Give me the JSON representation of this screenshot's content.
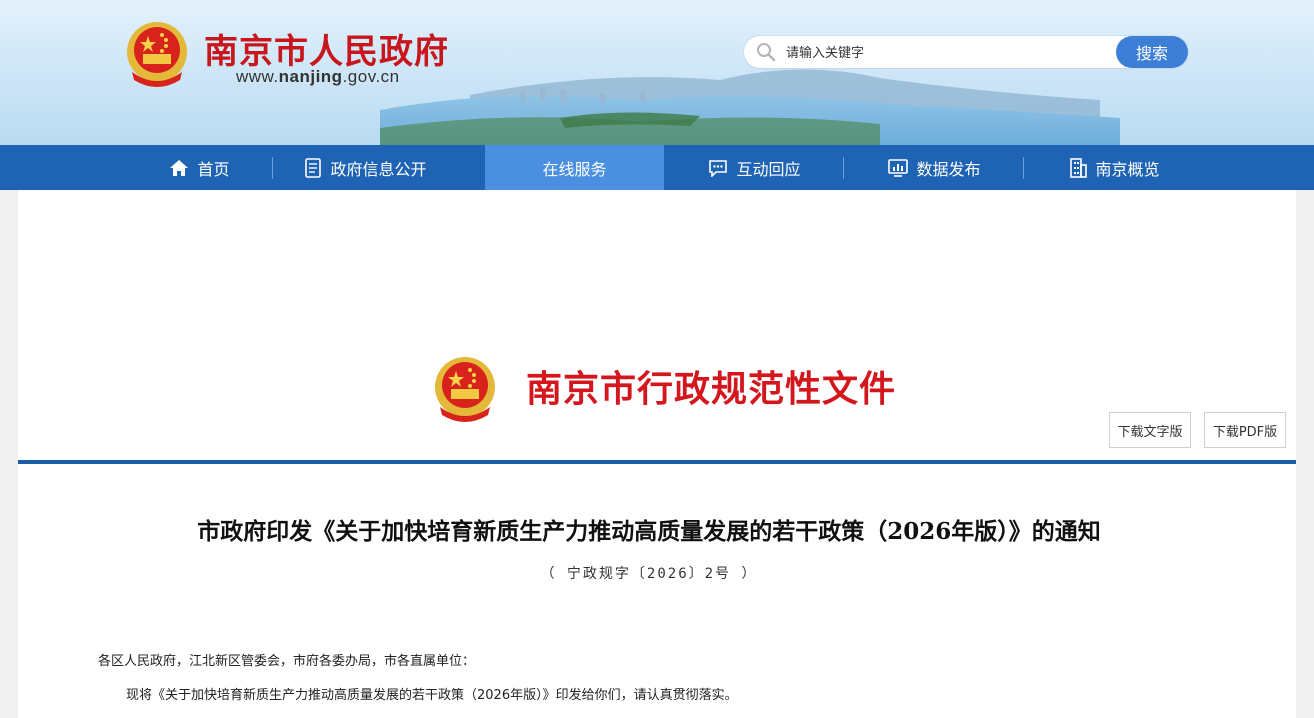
{
  "header": {
    "site_title": "南京市人民政府",
    "site_url_prefix": "www.",
    "site_url_domain": "nanjing",
    "site_url_suffix": ".gov.cn",
    "search_placeholder": "请输入关键字",
    "search_button": "搜索"
  },
  "nav": {
    "items": [
      {
        "label": "首页",
        "icon": "home-icon"
      },
      {
        "label": "政府信息公开",
        "icon": "document-icon"
      },
      {
        "label": "在线服务",
        "icon": ""
      },
      {
        "label": "互动回应",
        "icon": "chat-icon"
      },
      {
        "label": "数据发布",
        "icon": "chart-icon"
      },
      {
        "label": "南京概览",
        "icon": "building-icon"
      }
    ],
    "active_index": 2
  },
  "document": {
    "type_heading": "南京市行政规范性文件",
    "download_text": "下载文字版",
    "download_pdf": "下载PDF版",
    "title": "市政府印发《关于加快培育新质生产力推动高质量发展的若干政策（2026年版）》的通知",
    "number": "（ 宁政规字〔2026〕2号 ）",
    "salutation": "各区人民政府，江北新区管委会，市府各委办局，市各直属单位：",
    "body_line1": "现将《关于加快培育新质生产力推动高质量发展的若干政策（2026年版）》印发给你们，请认真贯彻落实。"
  },
  "colors": {
    "nav_bg": "#1f63b4",
    "nav_active": "#4a8fe0",
    "title_red": "#c8161d",
    "divider_blue": "#1a5ea8"
  }
}
